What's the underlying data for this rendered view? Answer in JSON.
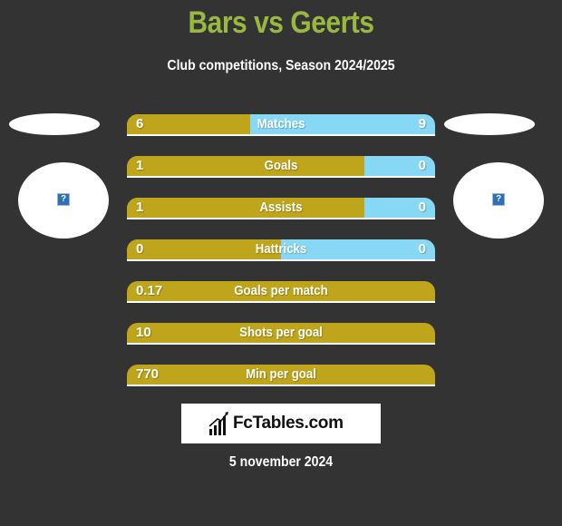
{
  "header": {
    "title": "Bars vs Geerts",
    "subtitle": "Club competitions, Season 2024/2025"
  },
  "players": {
    "left": {
      "name": "Bars",
      "avatar_icon": "question-mark-icon",
      "avatar_glyph": "?"
    },
    "right": {
      "name": "Geerts",
      "avatar_icon": "question-mark-icon",
      "avatar_glyph": "?"
    }
  },
  "colors": {
    "left": "#bfa51b",
    "right": "#87d8f5",
    "title": "#9ab83f",
    "background": "#333333"
  },
  "stats": [
    {
      "label": "Matches",
      "left": "6",
      "right": "9",
      "left_share": 0.4
    },
    {
      "label": "Goals",
      "left": "1",
      "right": "0",
      "left_share": 0.77
    },
    {
      "label": "Assists",
      "left": "1",
      "right": "0",
      "left_share": 0.77
    },
    {
      "label": "Hattricks",
      "left": "0",
      "right": "0",
      "left_share": 0.5
    },
    {
      "label": "Goals per match",
      "left": "0.17",
      "right": null,
      "left_share": 1
    },
    {
      "label": "Shots per goal",
      "left": "10",
      "right": null,
      "left_share": 1
    },
    {
      "label": "Min per goal",
      "left": "770",
      "right": null,
      "left_share": 1
    }
  ],
  "footer": {
    "logo_text": "FcTables.com",
    "date": "5 november 2024"
  }
}
